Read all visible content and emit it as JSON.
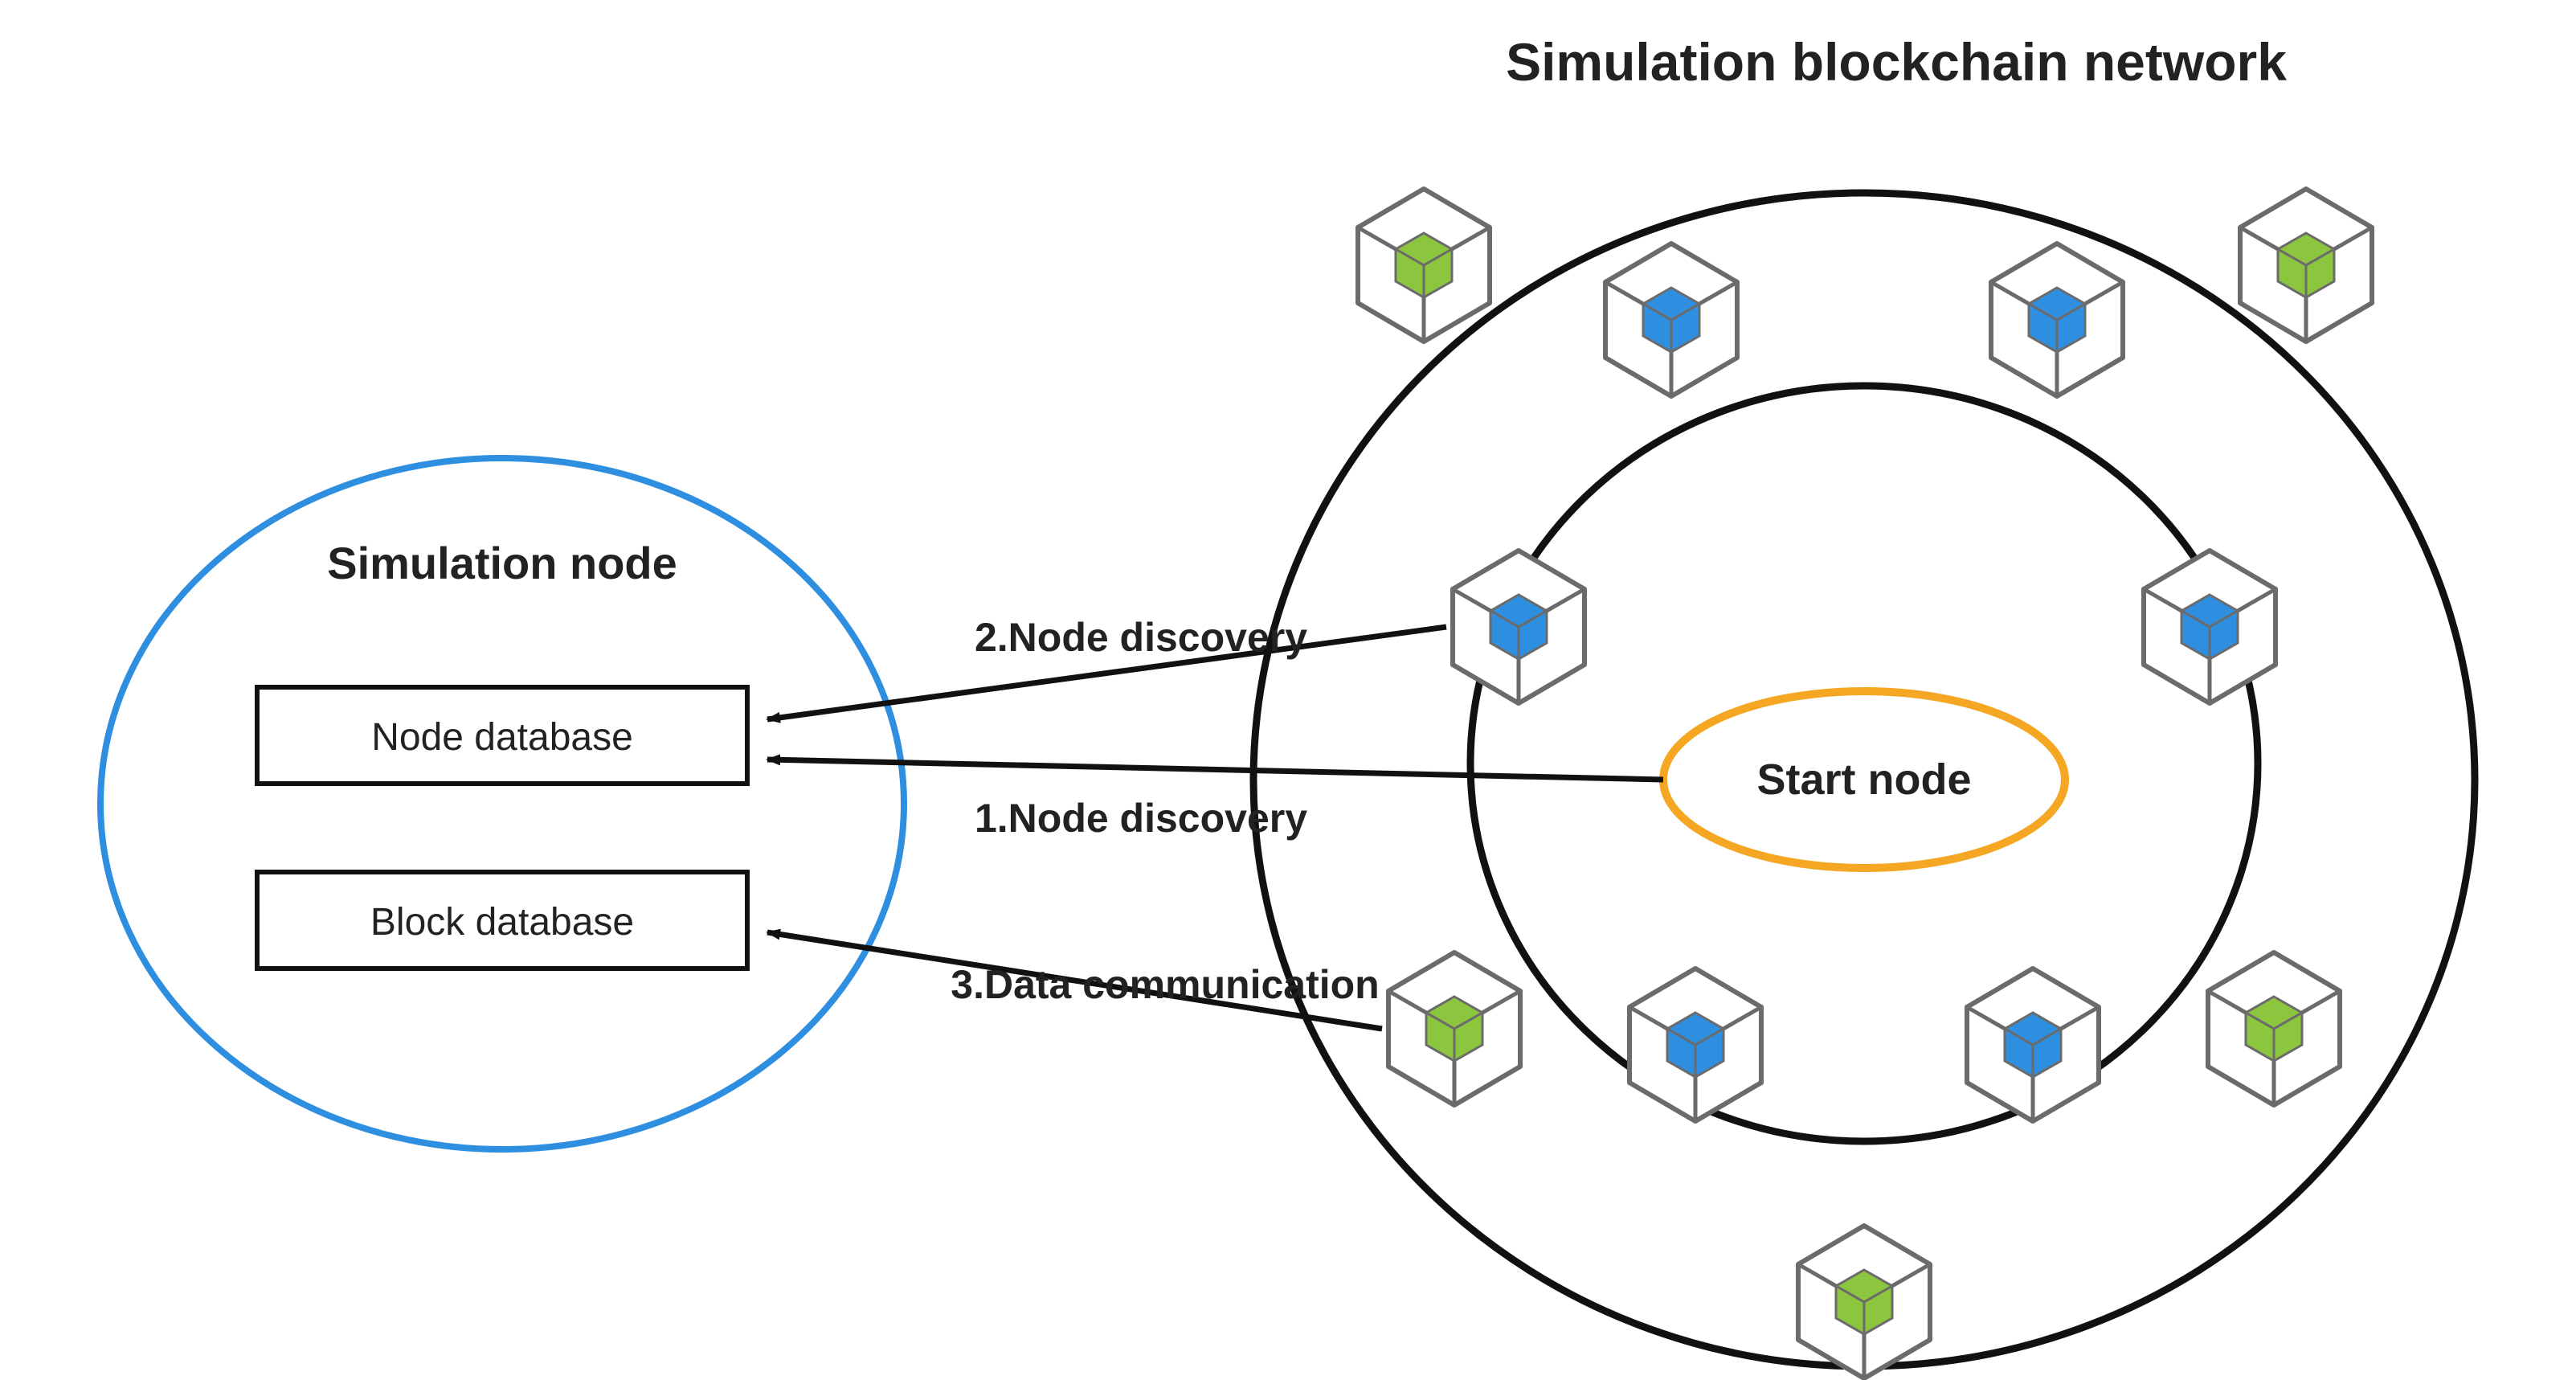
{
  "titles": {
    "network": "Simulation blockchain network",
    "sim_node": "Simulation node"
  },
  "boxes": {
    "node_db": "Node database",
    "block_db": "Block database"
  },
  "center": "Start node",
  "arrows": {
    "a1": "1.Node discovery",
    "a2": "2.Node discovery",
    "a3": "3.Data communication"
  },
  "colors": {
    "network_title": "#222222",
    "sim_node_stroke": "#2E8EE0",
    "start_node_stroke": "#F5A623",
    "cube_line": "#6B6B6B",
    "cube_blue": "#2E8EE0",
    "cube_green": "#8CC63F",
    "arrow": "#111111"
  }
}
